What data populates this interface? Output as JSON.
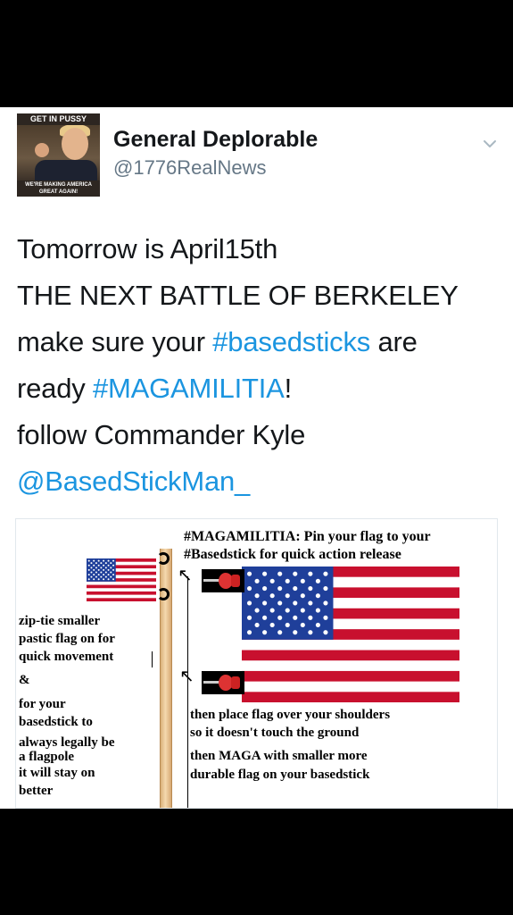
{
  "tweet": {
    "display_name": "General Deplorable",
    "handle": "@1776RealNews",
    "avatar": {
      "top_text": "GET IN PUSSY",
      "bottom_text": "WE'RE MAKING AMERICA GREAT AGAIN!"
    },
    "lines": [
      {
        "plain": "Tomorrow is April15th"
      },
      {
        "plain": "THE NEXT BATTLE OF BERKELEY"
      },
      {
        "pre": "make sure your ",
        "link": "#basedsticks",
        "post": " are"
      },
      {
        "pre": "ready ",
        "link": "#MAGAMILITIA",
        "post": "!"
      },
      {
        "plain": "follow Commander Kyle"
      },
      {
        "link": "@BasedStickMan_"
      }
    ]
  },
  "meme": {
    "headline_1": "#MAGAMILITIA: Pin your flag to your",
    "headline_2": "#Basedstick for quick action release",
    "left_1": "zip-tie smaller",
    "left_2": "pastic flag on for",
    "left_3": "quick movement",
    "left_4": "&",
    "left_5": "for your",
    "left_6": "basedstick to",
    "left_7": "always legally be",
    "left_8": "a flagpole",
    "left_9": "it will stay on",
    "left_10": "better",
    "right_1": "then place flag over your shoulders",
    "right_2": "so it doesn't touch the ground",
    "right_3": "then MAGA with smaller more",
    "right_4": "durable flag on your basedstick"
  },
  "colors": {
    "link": "#1b95e0",
    "flag_red": "#c8102e",
    "flag_blue": "#1f3f9a"
  }
}
